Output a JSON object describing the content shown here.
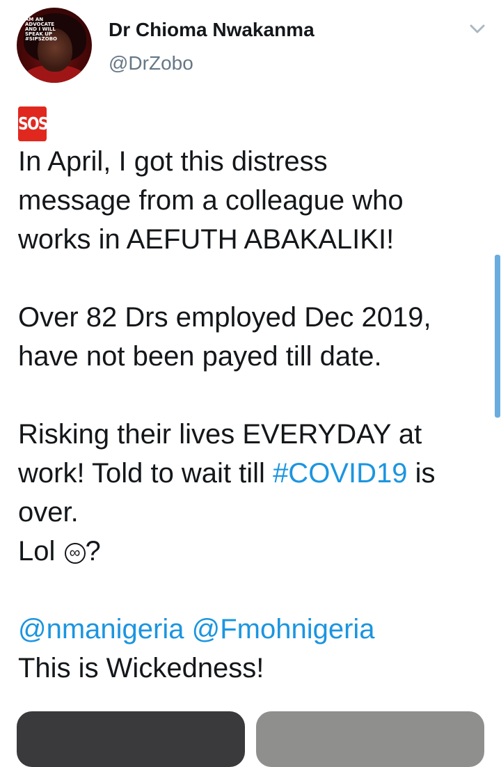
{
  "author": {
    "display_name": "Dr Chioma Nwakanma",
    "handle": "@DrZobo",
    "avatar_caption": [
      "AM AN",
      "ADVOCATE",
      "AND I WILL",
      "SPEAK UP",
      "#SIPSZOBO"
    ]
  },
  "tweet": {
    "badge": "SOS",
    "lines": [
      "In April, I got this distress",
      "message from a colleague who",
      "works in AEFUTH ABAKALIKI!",
      "Over 82 Drs employed Dec 2019,",
      "have not been payed till date.",
      "Risking their lives EVERYDAY at",
      "work! Told to wait till ",
      "over.",
      "Lol ",
      "This is Wickedness!"
    ],
    "hashtag": "#COVID19",
    "hashtag_suffix": " is",
    "emoji_symbol": "∞",
    "lol_suffix": "?",
    "mentions": [
      "@nmanigeria",
      "@Fmohnigeria"
    ]
  },
  "icons": {
    "menu": "chevron-down-icon",
    "badge": "sos-emoji-icon",
    "emoji": "infinity-emoji-icon"
  },
  "colors": {
    "link": "#1b95e0",
    "text": "#14171a",
    "secondary": "#657786",
    "sos_badge": "#e0281f",
    "media_left": "#3a393b",
    "media_right": "#8f8f8e"
  }
}
